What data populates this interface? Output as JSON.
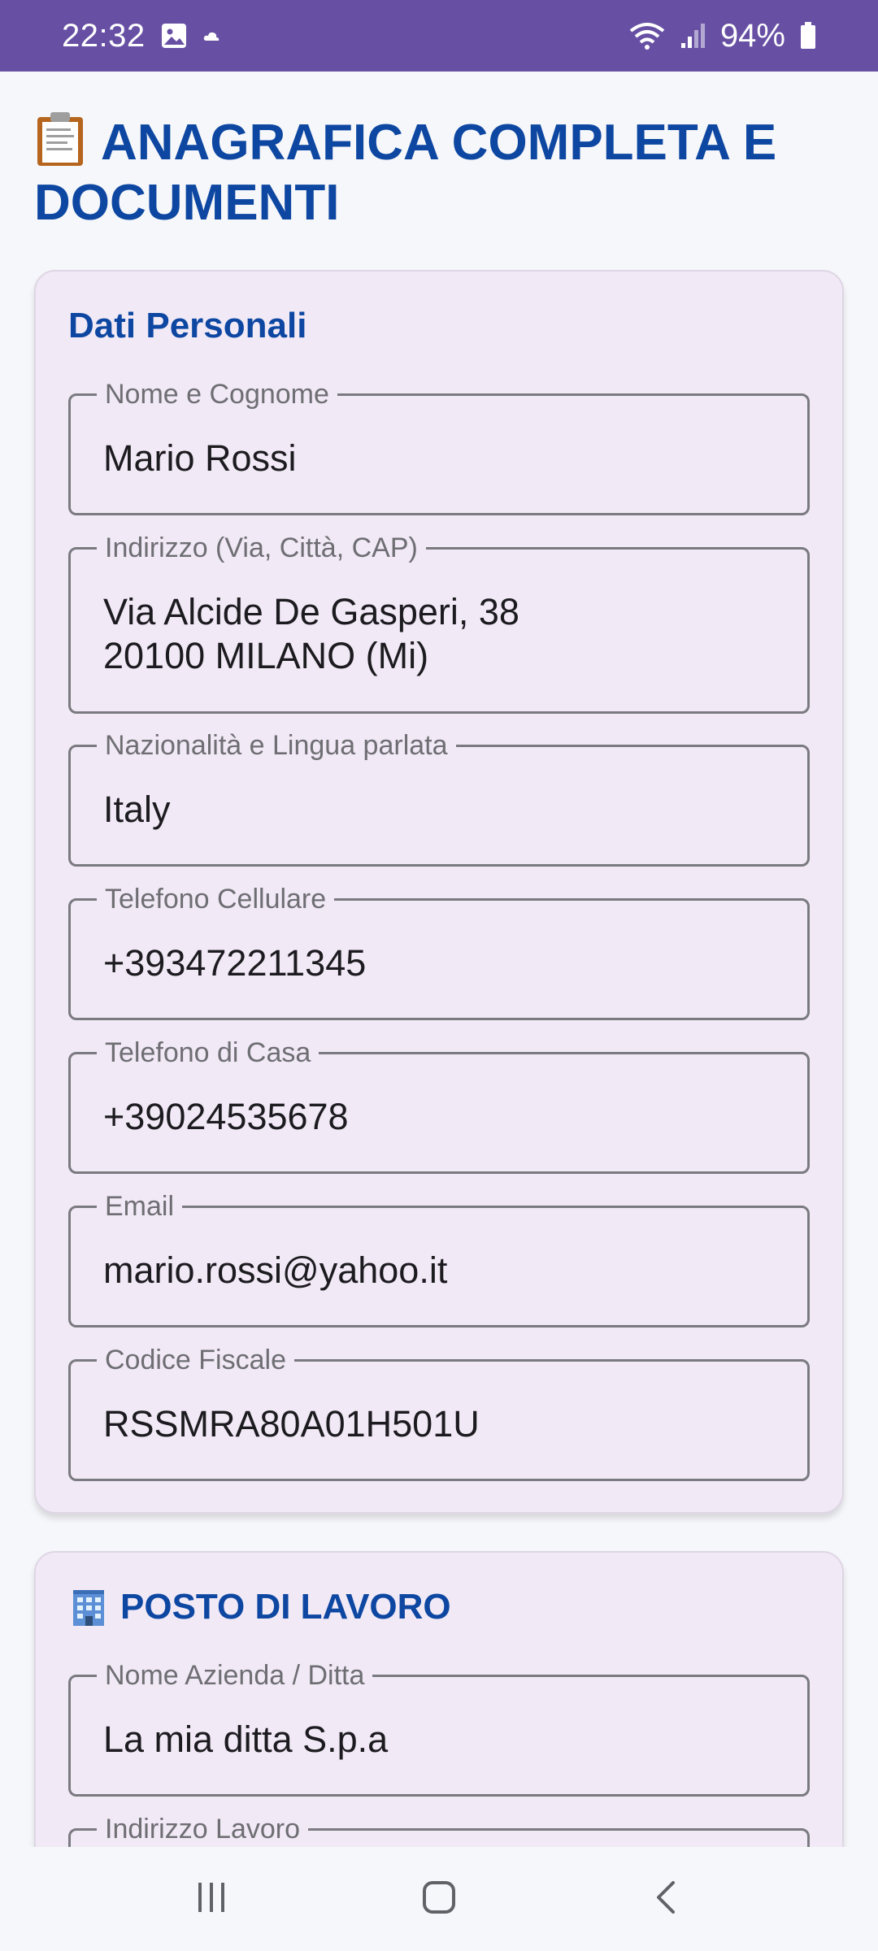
{
  "status_bar": {
    "time": "22:32",
    "battery": "94%",
    "icons": [
      "gallery-icon",
      "cloud-icon",
      "wifi-icon",
      "signal-icon",
      "battery-icon"
    ]
  },
  "page": {
    "title": "ANAGRAFICA COMPLETA E DOCUMENTI",
    "title_icon": "clipboard-icon"
  },
  "personal": {
    "title": "Dati Personali",
    "fields": [
      {
        "label": "Nome e Cognome",
        "value": "Mario Rossi"
      },
      {
        "label": "Indirizzo (Via, Città, CAP)",
        "value": "Via Alcide De Gasperi, 38\n20100 MILANO (Mi)"
      },
      {
        "label": "Nazionalità e Lingua parlata",
        "value": "Italy"
      },
      {
        "label": "Telefono Cellulare",
        "value": "+393472211345"
      },
      {
        "label": "Telefono di Casa",
        "value": "+39024535678"
      },
      {
        "label": "Email",
        "value": "mario.rossi@yahoo.it"
      },
      {
        "label": "Codice Fiscale",
        "value": "RSSMRA80A01H501U"
      }
    ]
  },
  "work": {
    "title": "POSTO DI LAVORO",
    "title_icon": "office-building-icon",
    "fields": [
      {
        "label": "Nome Azienda / Ditta",
        "value": "La mia ditta S.p.a"
      },
      {
        "label": "Indirizzo Lavoro",
        "value": ""
      }
    ]
  },
  "nav": {
    "buttons": [
      "recent-apps-icon",
      "home-icon",
      "back-icon"
    ]
  },
  "colors": {
    "status_bar": "#6750a4",
    "title": "#0d47a1",
    "card_bg": "#f1e9f6",
    "page_bg": "#f6f7fa"
  }
}
